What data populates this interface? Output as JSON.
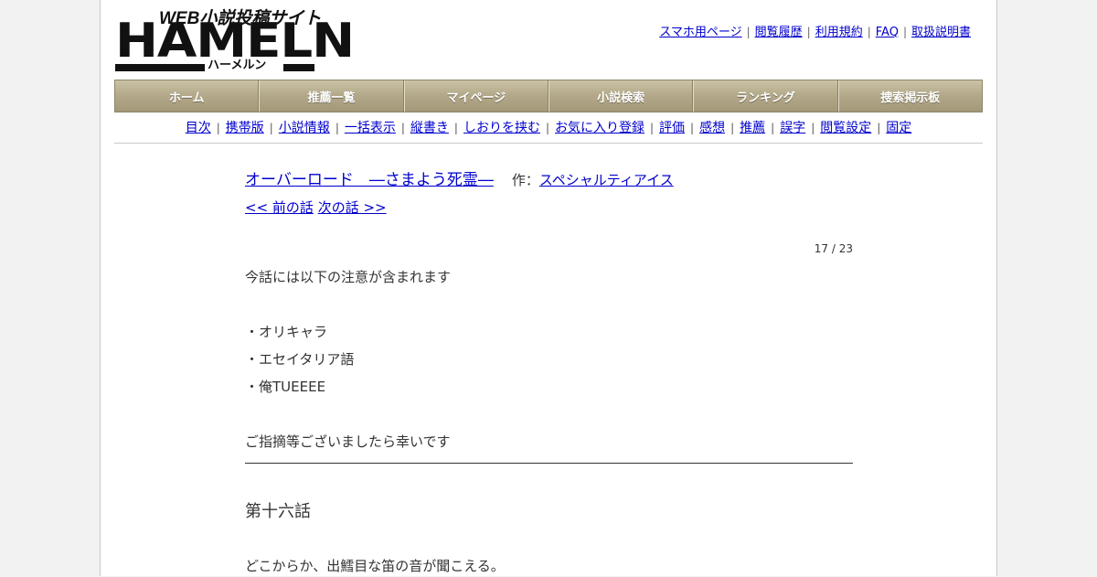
{
  "logo": {
    "tagline": "WEB小説投稿サイト",
    "wordmark": "HAMELN",
    "subtitle": "ハーメルン"
  },
  "top_links": [
    "スマホ用ページ",
    "閲覧履歴",
    "利用規約",
    "FAQ",
    "取扱説明書"
  ],
  "nav": [
    "ホーム",
    "推薦一覧",
    "マイページ",
    "小説検索",
    "ランキング",
    "捜索掲示板"
  ],
  "subnav": [
    "目次",
    "携帯版",
    "小説情報",
    "一括表示",
    "縦書き",
    "しおりを挟む",
    "お気に入り登録",
    "評価",
    "感想",
    "推薦",
    "誤字",
    "閲覧設定",
    "固定"
  ],
  "separator": "|",
  "novel": {
    "title": "オーバーロード　―さまよう死霊―",
    "author_prefix": "作：",
    "author": "スペシャルティアイス",
    "prev_label": "<< 前の話",
    "next_label": "次の話 >>",
    "counter": "17 / 23"
  },
  "preface": [
    "今話には以下の注意が含まれます",
    "",
    "・オリキャラ",
    "・エセイタリア語",
    "・俺TUEEEE",
    "",
    "ご指摘等ございましたら幸いです"
  ],
  "chapter_title": "第十六話",
  "body_first_line": "どこからか、出鱈目な笛の音が聞こえる。",
  "colors": {
    "link": "#0000cc",
    "nav_bg": "#b4aa8b",
    "page_bg": "#f2f2f2"
  }
}
